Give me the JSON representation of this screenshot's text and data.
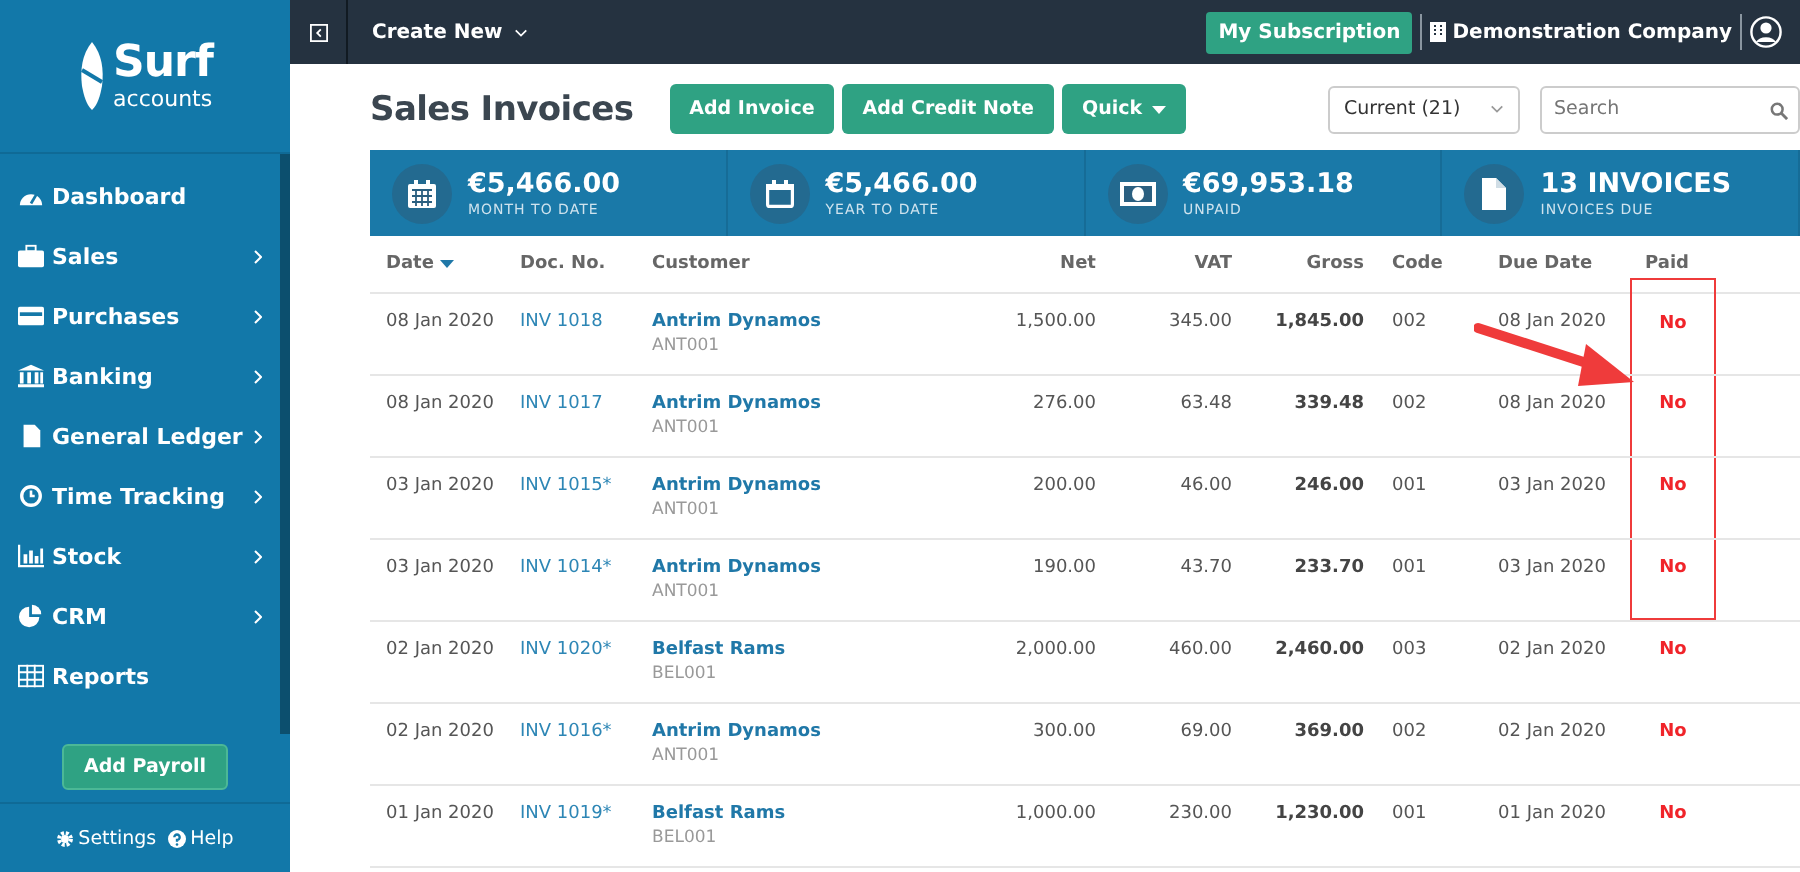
{
  "sidebar": {
    "logo": {
      "name": "Surf",
      "sub": "accounts"
    },
    "items": [
      {
        "label": "Dashboard",
        "has_submenu": false
      },
      {
        "label": "Sales",
        "has_submenu": true
      },
      {
        "label": "Purchases",
        "has_submenu": true
      },
      {
        "label": "Banking",
        "has_submenu": true
      },
      {
        "label": "General Ledger",
        "has_submenu": true
      },
      {
        "label": "Time Tracking",
        "has_submenu": true
      },
      {
        "label": "Stock",
        "has_submenu": true
      },
      {
        "label": "CRM",
        "has_submenu": true
      },
      {
        "label": "Reports",
        "has_submenu": false
      }
    ],
    "payroll_button": "Add Payroll",
    "footer_links": [
      "Settings",
      "Help"
    ]
  },
  "topbar": {
    "create_menu": "Create New",
    "subscription_button": "My Subscription",
    "company": "Demonstration Company"
  },
  "page": {
    "title": "Sales Invoices",
    "buttons": [
      {
        "label": "Add Invoice",
        "dropdown": false
      },
      {
        "label": "Add Credit Note",
        "dropdown": false
      },
      {
        "label": "Quick",
        "dropdown": true
      }
    ],
    "filter": {
      "value": "Current (21)"
    },
    "search": {
      "placeholder": "Search"
    }
  },
  "stats": [
    {
      "value": "€5,466.00",
      "label": "MONTH TO DATE"
    },
    {
      "value": "€5,466.00",
      "label": "YEAR TO DATE"
    },
    {
      "value": "€69,953.18",
      "label": "UNPAID"
    },
    {
      "value": "13 INVOICES",
      "label": "INVOICES DUE"
    }
  ],
  "table": {
    "columns": [
      {
        "label": "Date",
        "sorted": true
      },
      {
        "label": "Doc. No.",
        "sorted": false
      },
      {
        "label": "Customer",
        "sorted": false
      },
      {
        "label": "Net",
        "sorted": false
      },
      {
        "label": "VAT",
        "sorted": false
      },
      {
        "label": "Gross",
        "sorted": false
      },
      {
        "label": "Code",
        "sorted": false
      },
      {
        "label": "Due Date",
        "sorted": false
      },
      {
        "label": "Paid",
        "sorted": false
      }
    ],
    "rows": [
      {
        "date": "08 Jan 2020",
        "doc": "INV 1018",
        "customer": "Antrim Dynamos",
        "customer_code": "ANT001",
        "net": "1,500.00",
        "vat": "345.00",
        "gross": "1,845.00",
        "code": "002",
        "due": "08 Jan 2020",
        "paid": "No",
        "highlighted": true
      },
      {
        "date": "08 Jan 2020",
        "doc": "INV 1017",
        "customer": "Antrim Dynamos",
        "customer_code": "ANT001",
        "net": "276.00",
        "vat": "63.48",
        "gross": "339.48",
        "code": "002",
        "due": "08 Jan 2020",
        "paid": "No",
        "highlighted": true
      },
      {
        "date": "03 Jan 2020",
        "doc": "INV 1015*",
        "customer": "Antrim Dynamos",
        "customer_code": "ANT001",
        "net": "200.00",
        "vat": "46.00",
        "gross": "246.00",
        "code": "001",
        "due": "03 Jan 2020",
        "paid": "No",
        "highlighted": true
      },
      {
        "date": "03 Jan 2020",
        "doc": "INV 1014*",
        "customer": "Antrim Dynamos",
        "customer_code": "ANT001",
        "net": "190.00",
        "vat": "43.70",
        "gross": "233.70",
        "code": "001",
        "due": "03 Jan 2020",
        "paid": "No",
        "highlighted": true
      },
      {
        "date": "02 Jan 2020",
        "doc": "INV 1020*",
        "customer": "Belfast Rams",
        "customer_code": "BEL001",
        "net": "2,000.00",
        "vat": "460.00",
        "gross": "2,460.00",
        "code": "003",
        "due": "02 Jan 2020",
        "paid": "No",
        "highlighted": false
      },
      {
        "date": "02 Jan 2020",
        "doc": "INV 1016*",
        "customer": "Antrim Dynamos",
        "customer_code": "ANT001",
        "net": "300.00",
        "vat": "69.00",
        "gross": "369.00",
        "code": "002",
        "due": "02 Jan 2020",
        "paid": "No",
        "highlighted": false
      },
      {
        "date": "01 Jan 2020",
        "doc": "INV 1019*",
        "customer": "Belfast Rams",
        "customer_code": "BEL001",
        "net": "1,000.00",
        "vat": "230.00",
        "gross": "1,230.00",
        "code": "001",
        "due": "01 Jan 2020",
        "paid": "No",
        "highlighted": false
      }
    ],
    "callout_arrow": true
  }
}
